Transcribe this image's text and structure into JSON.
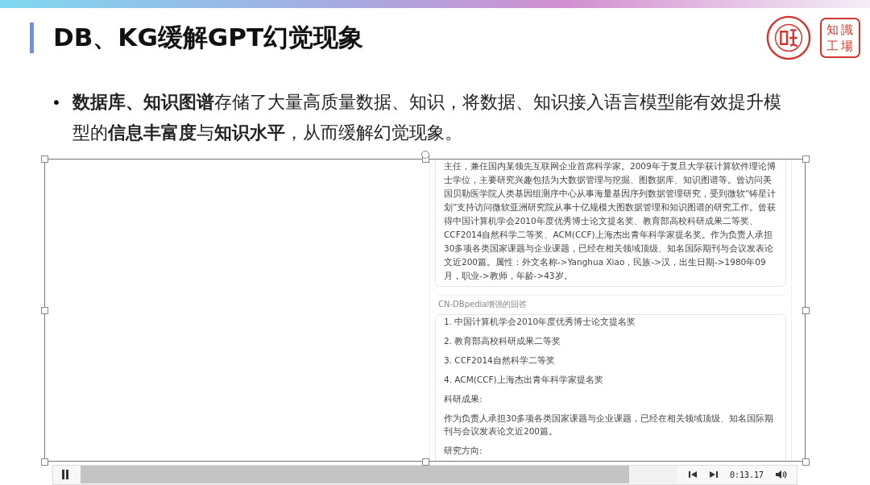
{
  "slide": {
    "title": "DB、KG缓解GPT幻觉现象",
    "bullet_marker": "•",
    "bullet": "**数据库、知识图谱**存储了大量高质量数据、知识，将数据、知识接入语言模型能有效提升模型的**信息丰富度**与**知识水平**，从而缓解幻觉现象。",
    "seal_text": "知識工場"
  },
  "video": {
    "selected": true,
    "card_text": "主任，兼任国内某领先互联网企业首席科学家。2009年于复旦大学获计算软件理论博士学位，主要研究兴趣包括为大数据管理与挖掘、图数据库、知识图谱等。曾访问美国贝勒医学院人类基因组测序中心从事海量基因序列数据管理研究，受到微软“铸星计划”支持访问微软亚洲研究院从事十亿规模大图数据管理和知识图谱的研究工作。曾获得中国计算机学会2010年度优秀博士论文提名奖、教育部高校科研成果二等奖、CCF2014自然科学二等奖、ACM(CCF)上海杰出青年科学家提名奖。作为负责人承担30多项各类国家课题与企业课题，已经在相关领域顶级、知名国际期刊与会议发表论文近200篇。属性：外文名称->Yanghua Xiao，民族->汉，出生日期->1980年09月，职业->教师，年龄->43岁。",
    "section_label": "CN-DBpedia增强的回答",
    "answer_lines": [
      "1. 中国计算机学会2010年度优秀博士论文提名奖",
      "2. 教育部高校科研成果二等奖",
      "3. CCF2014自然科学二等奖",
      "4. ACM(CCF)上海杰出青年科学家提名奖",
      "科研成果:",
      "作为负责人承担30多项各类国家课题与企业课题，已经在相关领域顶级、知名国际期刊与会议发表论文近200篇。",
      "研究方向:"
    ],
    "player": {
      "playing": true,
      "level": 0.92,
      "time": "0:13.17"
    }
  }
}
